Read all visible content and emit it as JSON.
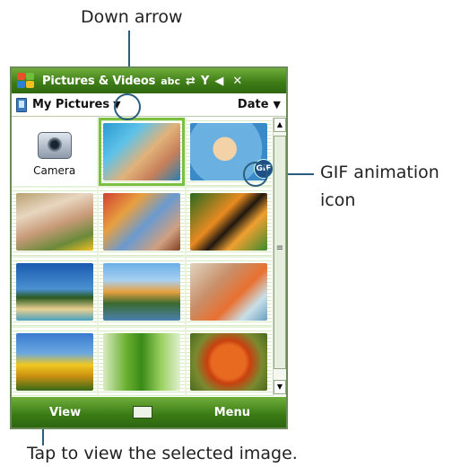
{
  "callouts": {
    "down_arrow": "Down arrow",
    "gif_icon_line1": "GIF animation",
    "gif_icon_line2": "icon",
    "view_tip": "Tap to view the selected image."
  },
  "titlebar": {
    "title": "Pictures & Videos",
    "icons": [
      "start-icon",
      "input-icon",
      "sync-icon",
      "signal-icon",
      "volume-icon",
      "close-icon"
    ],
    "input_glyph": "abc",
    "sync_glyph": "⇄",
    "signal_glyph": "Y",
    "volume_glyph": "◀",
    "close_glyph": "✕"
  },
  "toolbar": {
    "folder": "My Pictures",
    "dropdown_glyph": "▼",
    "sort": "Date",
    "sort_glyph": "▼"
  },
  "grid": {
    "camera_label": "Camera",
    "gif_badge": "GIF",
    "colors": {
      "selected_outline": "#7bc043",
      "stripe": "#d8ecc4"
    }
  },
  "softkeys": {
    "left": "View",
    "right": "Menu"
  },
  "scrollbar": {
    "up_glyph": "▲",
    "down_glyph": "▼",
    "thumb_glyph": "≡"
  },
  "colors": {
    "bar_green": "#3f7d18",
    "callout_line": "#2b5d7f"
  }
}
